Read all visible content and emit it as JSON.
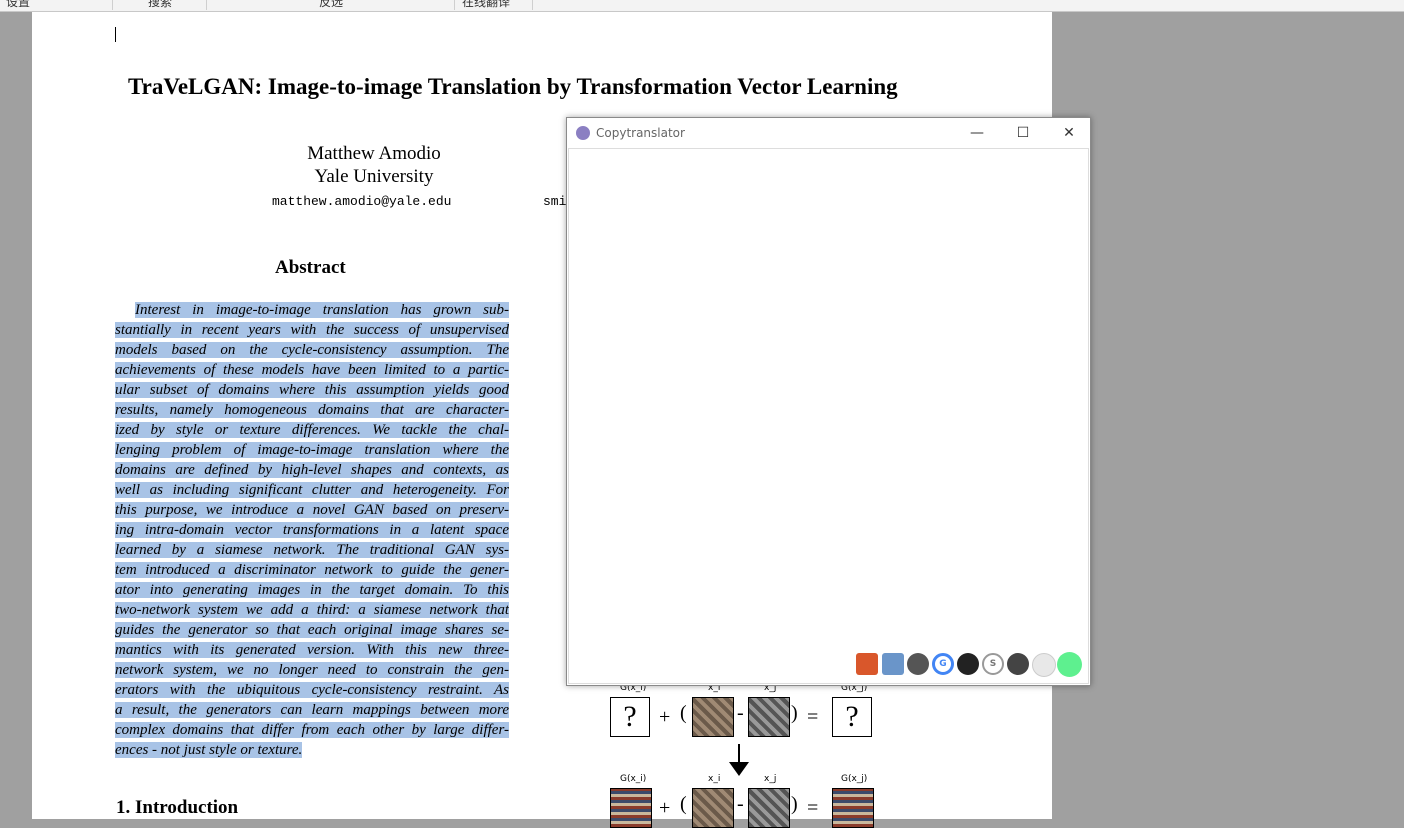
{
  "top_tabs": [
    "设置",
    "搜索",
    "反选",
    "在线翻译"
  ],
  "paper": {
    "title": "TraVeLGAN: Image-to-image Translation by Transformation Vector Learning",
    "author_name": "Matthew Amodio",
    "author_affiliation": "Yale University",
    "author_email": "matthew.amodio@yale.edu",
    "second_email_partial": "smi",
    "abstract_heading": "Abstract",
    "abstract_lines": [
      "Interest in image-to-image translation has grown sub-",
      "stantially in recent years with the success of unsupervised",
      "models based on the cycle-consistency assumption. The",
      "achievements of these models have been limited to a partic-",
      "ular subset of domains where this assumption yields good",
      "results, namely homogeneous domains that are character-",
      "ized by style or texture differences. We tackle the chal-",
      "lenging problem of image-to-image translation where the",
      "domains are defined by high-level shapes and contexts, as",
      "well as including significant clutter and heterogeneity. For",
      "this purpose, we introduce a novel GAN based on preserv-",
      "ing intra-domain vector transformations in a latent space",
      "learned by a siamese network. The traditional GAN sys-",
      "tem introduced a discriminator network to guide the gener-",
      "ator into generating images in the target domain. To this",
      "two-network system we add a third: a siamese network that",
      "guides the generator so that each original image shares se-",
      "mantics with its generated version. With this new three-",
      "network system, we no longer need to constrain the gen-",
      "erators with the ubiquitous cycle-consistency restraint. As",
      "a result, the generators can learn mappings between more",
      "complex domains that differ from each other by large differ-",
      "ences - not just style or texture."
    ],
    "intro_heading": "1. Introduction",
    "figure": {
      "row1_labels": [
        "G(x_i)",
        "x_i",
        "x_j",
        "G(x_j)"
      ],
      "row2_labels": [
        "G(x_i)",
        "x_i",
        "x_j",
        "G(x_j)"
      ],
      "question": "?",
      "plus": "+",
      "minus": "-",
      "equals": "=",
      "lparen": "(",
      "rparen": ")"
    }
  },
  "window": {
    "title": "Copytranslator",
    "minimize": "—",
    "maximize": "☐",
    "close": "✕",
    "toolbar_icons": [
      "home-icon",
      "docs-icon",
      "baidu-paw-icon",
      "google-icon",
      "youdao-icon",
      "sogou-icon",
      "caiyun-icon",
      "chat-icon",
      "status-dot-icon"
    ]
  },
  "colors": {
    "highlight": "#a8c3e6",
    "viewer_bg": "#a0a0a0",
    "status_green": "#5ef08f"
  }
}
